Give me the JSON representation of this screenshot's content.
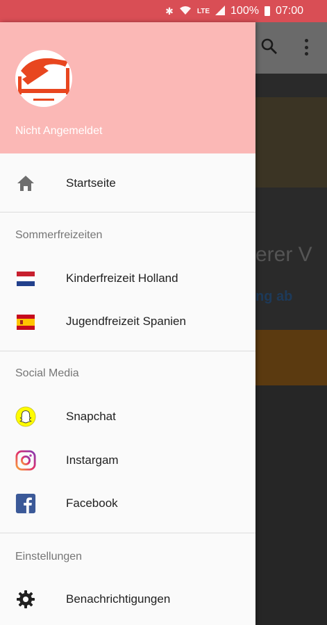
{
  "statusbar": {
    "bluetooth_icon": "bluetooth-icon",
    "wifi_icon": "wifi-icon",
    "lte_label": "LTE",
    "signal_icon": "signal-icon",
    "battery_percent": "100%",
    "time": "07:00"
  },
  "background_app": {
    "text_partial_1": "erer V",
    "text_partial_2": "ng ab"
  },
  "drawer": {
    "header": {
      "user_status": "Nicht Angemeldet",
      "background_color": "#fbb8b6"
    },
    "home": {
      "label": "Startseite",
      "icon": "home-icon"
    },
    "sections": [
      {
        "title": "Sommerfreizeiten",
        "items": [
          {
            "label": "Kinderfreizeit Holland",
            "icon": "netherlands-flag-icon"
          },
          {
            "label": "Jugendfreizeit Spanien",
            "icon": "spain-flag-icon"
          }
        ]
      },
      {
        "title": "Social Media",
        "items": [
          {
            "label": "Snapchat",
            "icon": "snapchat-icon"
          },
          {
            "label": "Instargam",
            "icon": "instagram-icon"
          },
          {
            "label": "Facebook",
            "icon": "facebook-icon"
          }
        ]
      },
      {
        "title": "Einstellungen",
        "items": [
          {
            "label": "Benachrichtigungen",
            "icon": "gear-icon"
          }
        ]
      }
    ]
  },
  "colors": {
    "statusbar": "#d94e55",
    "accent": "#fbb8b6"
  }
}
